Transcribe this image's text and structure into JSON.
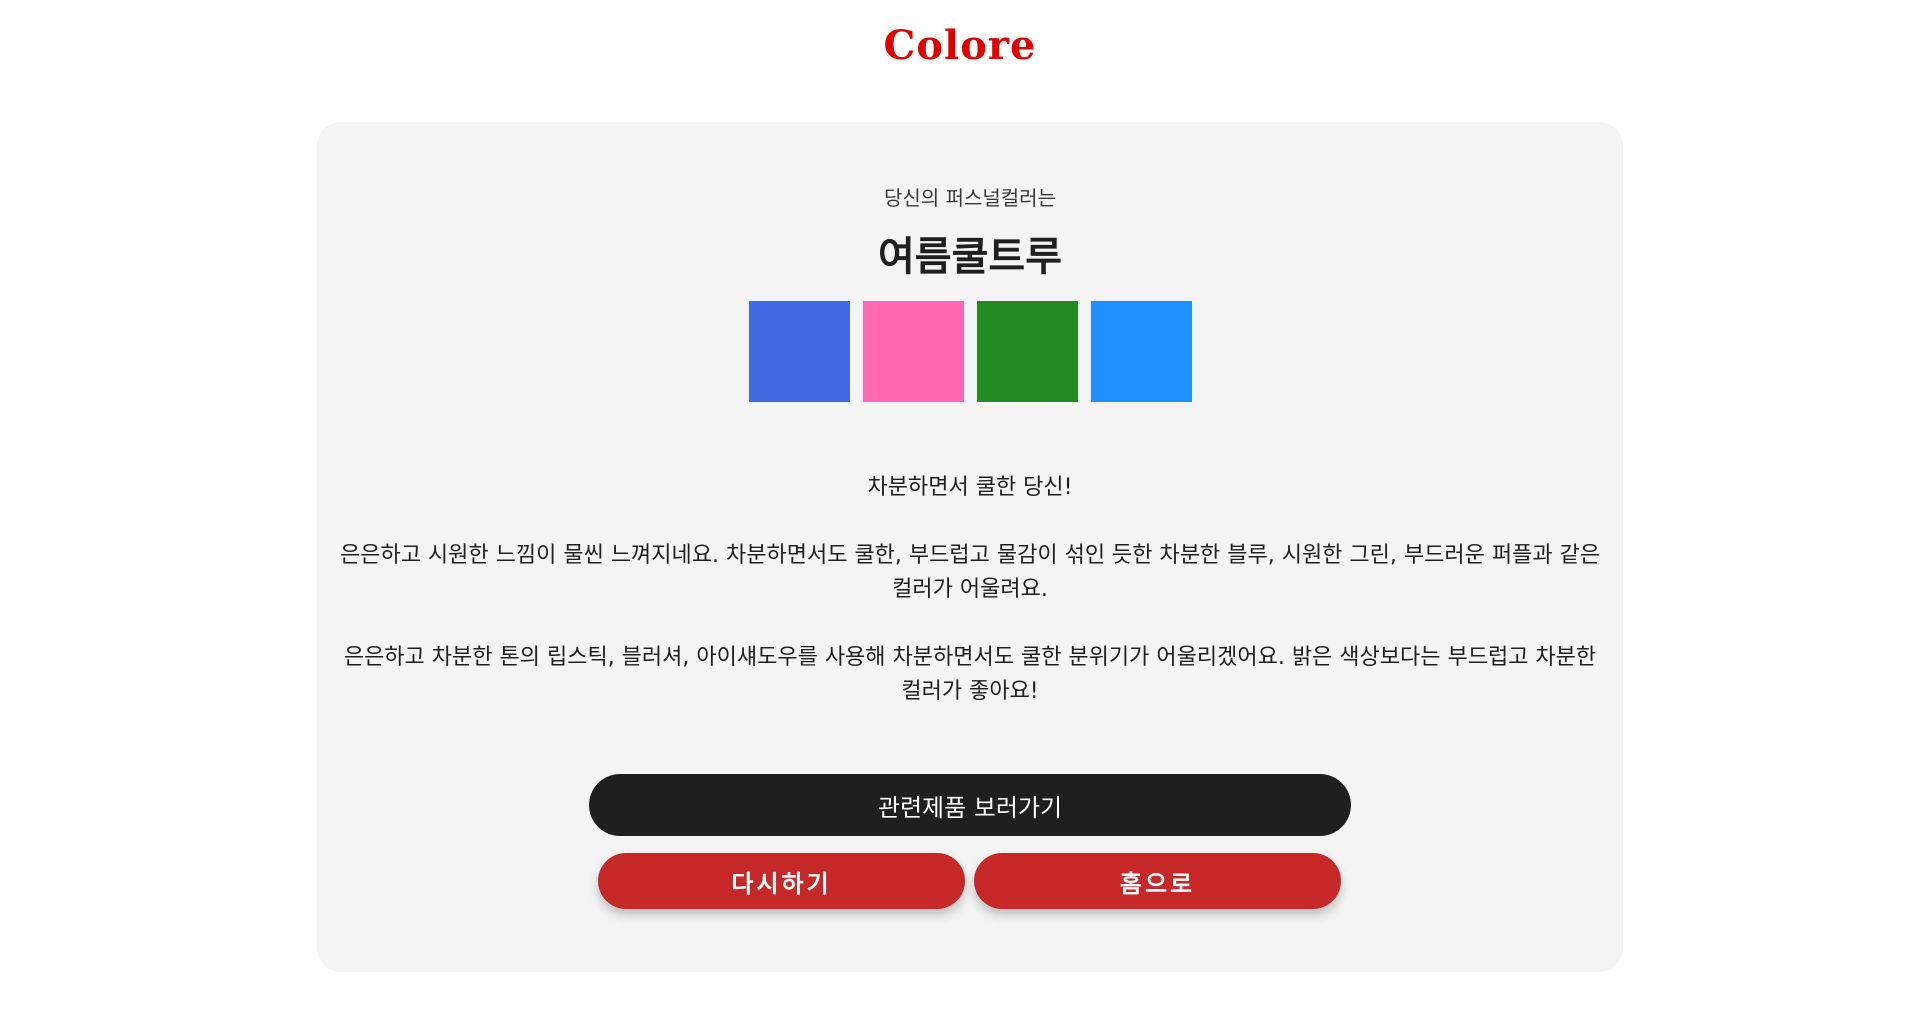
{
  "header": {
    "logo": "Colore"
  },
  "result": {
    "subtitle": "당신의 퍼스널컬러는",
    "title": "여름쿨트루",
    "swatches": [
      {
        "name": "swatch-royal-blue",
        "color": "#4169e1"
      },
      {
        "name": "swatch-hot-pink",
        "color": "#ff69b4"
      },
      {
        "name": "swatch-forest-green",
        "color": "#228b22"
      },
      {
        "name": "swatch-dodger-blue",
        "color": "#1e90ff"
      }
    ],
    "description": [
      "차분하면서 쿨한 당신!",
      "은은하고 시원한 느낌이 물씬 느껴지네요. 차분하면서도 쿨한, 부드럽고 물감이 섞인 듯한 차분한 블루, 시원한 그린, 부드러운 퍼플과 같은 컬러가 어울려요.",
      "은은하고 차분한 톤의 립스틱, 블러셔, 아이섀도우를 사용해 차분하면서도 쿨한 분위기가 어울리겠어요. 밝은 색상보다는 부드럽고 차분한 컬러가 좋아요!"
    ]
  },
  "buttons": {
    "products": "관련제품 보러가기",
    "retry": "다시하기",
    "home": "홈으로"
  },
  "colors": {
    "brand": "#e00000",
    "card_bg": "#f4f4f4",
    "dark_button": "#1f1f1f",
    "red_button": "#c62828"
  }
}
